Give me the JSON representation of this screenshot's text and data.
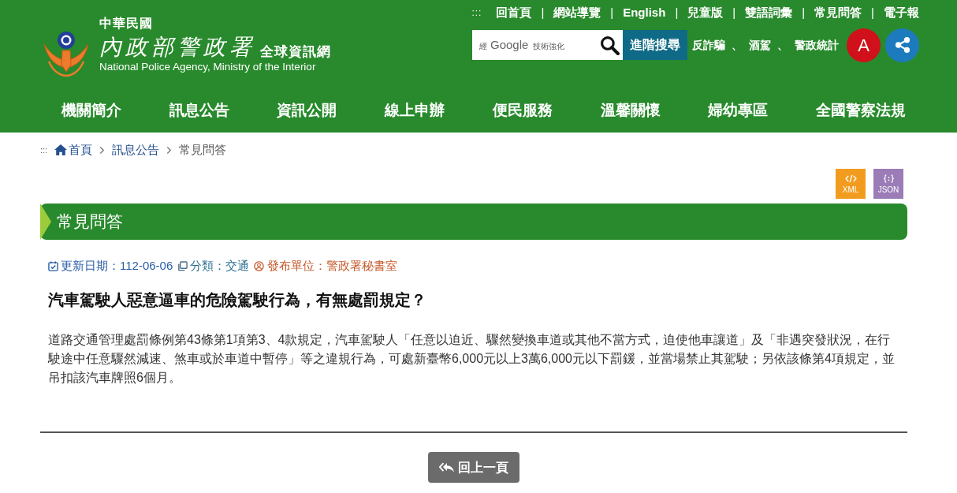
{
  "header": {
    "logo": {
      "country": "中華民國",
      "agency": "內政部警政署",
      "site": "全球資訊網",
      "english": "National Police Agency, Ministry of the Interior"
    },
    "accesskey": ":::",
    "top_links": [
      {
        "label": "回首頁",
        "separator": "|"
      },
      {
        "label": "網站導覽",
        "separator": "|"
      },
      {
        "label": "English",
        "separator": "|"
      },
      {
        "label": "兒童版",
        "separator": "|"
      },
      {
        "label": "雙語詞彙",
        "separator": "|"
      },
      {
        "label": "常見問答",
        "separator": "|"
      },
      {
        "label": "電子報"
      }
    ],
    "search": {
      "branding_prefix": "經",
      "branding_brand": "Google",
      "branding_suffix": "技術強化",
      "advanced_button": "進階搜尋"
    },
    "hot_keywords": [
      {
        "label": "反詐騙",
        "separator": "、"
      },
      {
        "label": "酒駕",
        "separator": "、"
      },
      {
        "label": "警政統計"
      }
    ],
    "font_size_button": "A"
  },
  "nav": [
    "機關簡介",
    "訊息公告",
    "資訊公開",
    "線上申辦",
    "便民服務",
    "溫馨關懷",
    "婦幼專區",
    "全國警察法規"
  ],
  "breadcrumb": {
    "accesskey": ":::",
    "items": [
      {
        "label": "首頁",
        "kind": "home"
      },
      {
        "label": "訊息公告",
        "kind": "link"
      },
      {
        "label": "常見問答",
        "kind": "current"
      }
    ]
  },
  "feeds": [
    {
      "label": "XML",
      "kind": "xml",
      "color": "#f29c1f"
    },
    {
      "label": "JSON",
      "kind": "json",
      "color": "#9b7cb6"
    }
  ],
  "page_title": "常見問答",
  "meta": [
    {
      "kind": "date",
      "text": "更新日期：112-06-06",
      "color": "#2a5ea8"
    },
    {
      "kind": "category",
      "text": "分類：交通",
      "color": "#2b6f8f"
    },
    {
      "kind": "unit",
      "text": "發布單位：警政署秘書室",
      "color": "#c4582a"
    }
  ],
  "question": "汽車駕駛人惡意逼車的危險駕駛行為，有無處罰規定？",
  "answer": "道路交通管理處罰條例第43條第1項第3、4款規定，汽車駕駛人「任意以迫近、驟然變換車道或其他不當方式，迫使他車讓道」及「非遇突發狀況，在行駛途中任意驟然減速、煞車或於車道中暫停」等之違規行為，可處新臺幣6,000元以上3萬6,000元以下罰鍰，並當場禁止其駕駛；另依該條第4項規定，並吊扣該汽車牌照6個月。",
  "back_button": "回上一頁"
}
